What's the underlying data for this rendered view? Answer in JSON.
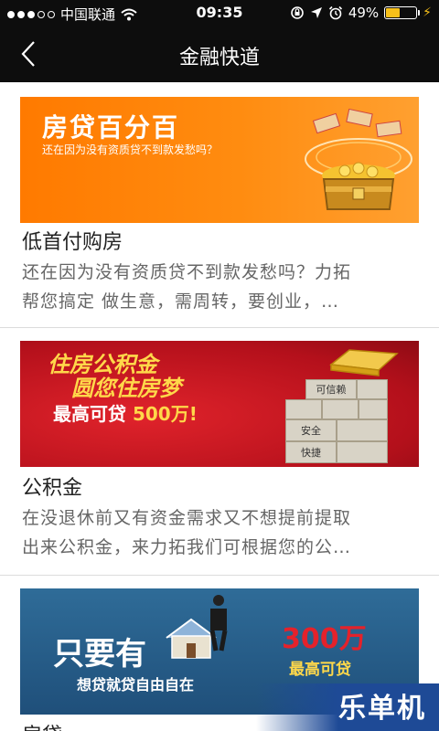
{
  "status_bar": {
    "carrier": "中国联通",
    "time": "09:35",
    "battery": "49%",
    "battery_level": 0.49,
    "icons": [
      "signal-dots",
      "wifi-icon",
      "orientation-lock-icon",
      "location-arrow-icon",
      "alarm-icon",
      "battery-icon",
      "charging-bolt-icon"
    ]
  },
  "nav": {
    "title": "金融快道",
    "back_icon": "chevron-left-icon"
  },
  "cards": [
    {
      "banner_title": "房贷百分百",
      "banner_subtitle": "还在因为没有资质贷不到款发愁吗？",
      "title": "低首付购房",
      "desc_line1": "还在因为没有资质贷不到款发愁吗？力拓",
      "desc_line2": "帮您搞定 做生意，需周转，要创业，…"
    },
    {
      "banner_line1": "住房公积金",
      "banner_line2": "圆您住房梦",
      "banner_line3_prefix": "最高可贷 ",
      "banner_line3_amount": "500万!",
      "blocks": [
        "可信赖",
        "安全",
        "快捷"
      ],
      "title": "公积金",
      "desc_line1": "在没退休前又有资金需求又不想提前提取",
      "desc_line2": "出来公积金，来力拓我们可根据您的公…"
    },
    {
      "banner_line1": "只要有",
      "banner_line2": "想贷就贷自由自在",
      "banner_amount": "300万",
      "banner_amount_label": "最高可贷",
      "title": "房贷"
    }
  ],
  "watermark": "乐单机",
  "colors": {
    "bar_bg": "#0d0d0d",
    "battery_yellow": "#f7c01a",
    "orange_banner": "#ff7a00",
    "red_banner": "#c4141f",
    "blue_banner": "#2a5f8c"
  }
}
